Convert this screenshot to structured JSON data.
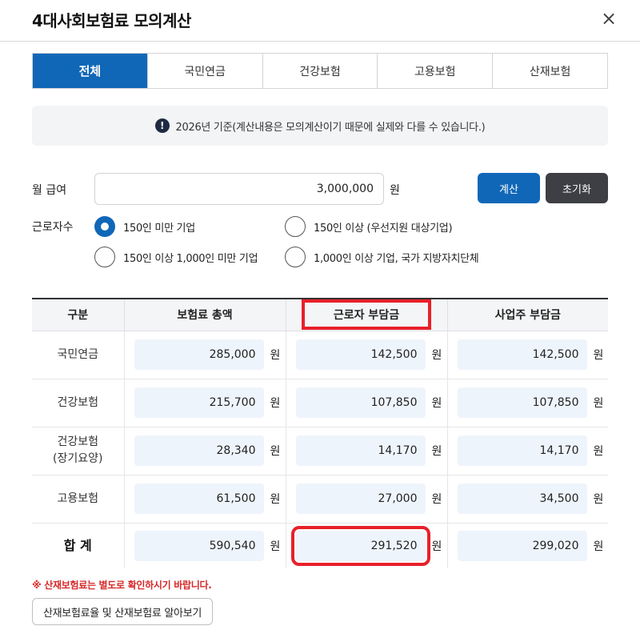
{
  "dialog": {
    "title": "4대사회보험료 모의계산",
    "close_icon": "×"
  },
  "tabs": [
    {
      "label": "전체",
      "active": true
    },
    {
      "label": "국민연금"
    },
    {
      "label": "건강보험"
    },
    {
      "label": "고용보험"
    },
    {
      "label": "산재보험"
    }
  ],
  "notice": {
    "icon": "!",
    "text": "2026년 기준(계산내용은 모의계산이기 때문에 실제와 다를 수 있습니다.)"
  },
  "form": {
    "salary_label": "월 급여",
    "salary_value": "3,000,000",
    "salary_unit": "원",
    "calc_button": "계산",
    "reset_button": "초기화",
    "workers_label": "근로자수",
    "options": [
      {
        "label": "150인 미만 기업",
        "checked": true
      },
      {
        "label": "150인 이상 (우선지원 대상기업)"
      },
      {
        "label": "150인 이상 1,000인 미만 기업"
      },
      {
        "label": "1,000인 이상 기업, 국가 지방자치단체"
      }
    ]
  },
  "table": {
    "headers": [
      "구분",
      "보험료 총액",
      "근로자 부담금",
      "사업주 부담금"
    ],
    "unit": "원",
    "rows": [
      {
        "name": "국민연금",
        "total": "285,000",
        "employee": "142,500",
        "employer": "142,500"
      },
      {
        "name": "건강보험",
        "total": "215,700",
        "employee": "107,850",
        "employer": "107,850"
      },
      {
        "name": "건강보험\n(장기요양)",
        "total": "28,340",
        "employee": "14,170",
        "employer": "14,170"
      },
      {
        "name": "고용보험",
        "total": "61,500",
        "employee": "27,000",
        "employer": "34,500"
      }
    ],
    "sum": {
      "name": "합 계",
      "total": "590,540",
      "employee": "291,520",
      "employer": "299,020"
    }
  },
  "footer": {
    "warning": "※ 산재보험료는 별도로 확인하시기 바랍니다.",
    "link_button": "산재보험료율 및 산재보험료 알아보기"
  },
  "colors": {
    "primary": "#1067b8",
    "dark_button": "#3d3f44",
    "highlight": "#e8202a",
    "warning": "#d62828",
    "value_bg": "#eef4fb"
  }
}
